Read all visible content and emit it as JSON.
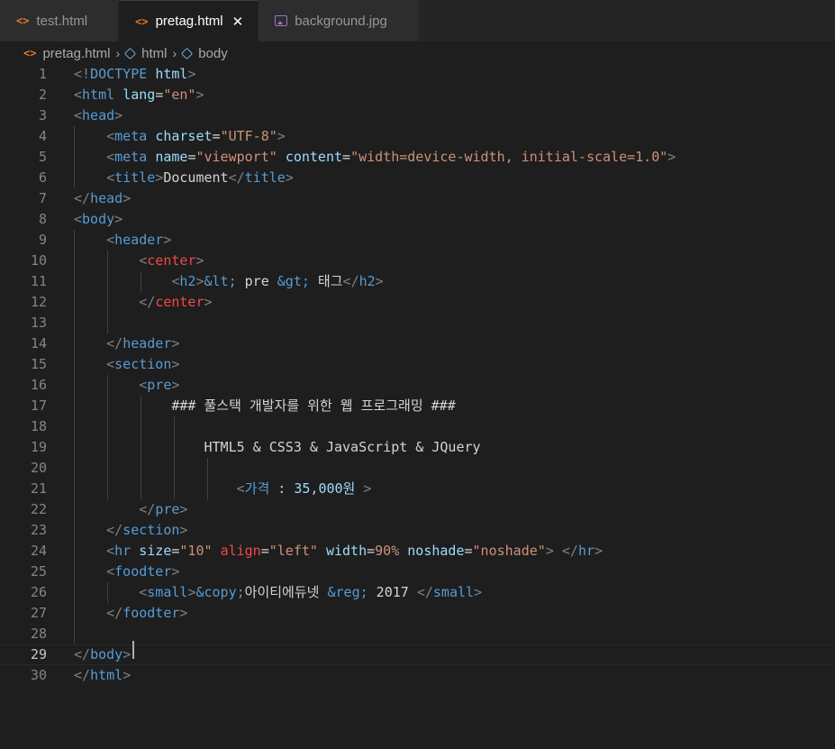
{
  "tabs": [
    {
      "label": "test.html",
      "icon": "html-file-icon",
      "active": false
    },
    {
      "label": "pretag.html",
      "icon": "html-file-icon",
      "active": true,
      "close": "✕"
    },
    {
      "label": "background.jpg",
      "icon": "image-file-icon",
      "active": false
    }
  ],
  "breadcrumb": [
    "pretag.html",
    "html",
    "body"
  ],
  "lines": [
    [
      [
        "t",
        "<!"
      ],
      [
        "n",
        "DOCTYPE"
      ],
      [
        "x",
        " "
      ],
      [
        "a",
        "html"
      ],
      [
        "t",
        ">"
      ]
    ],
    [
      [
        "t",
        "<"
      ],
      [
        "n",
        "html"
      ],
      [
        "x",
        " "
      ],
      [
        "a",
        "lang"
      ],
      [
        "x",
        "="
      ],
      [
        "s",
        "\"en\""
      ],
      [
        "t",
        ">"
      ]
    ],
    [
      [
        "t",
        "<"
      ],
      [
        "n",
        "head"
      ],
      [
        "t",
        ">"
      ]
    ],
    [
      [
        "x",
        "    "
      ],
      [
        "t",
        "<"
      ],
      [
        "n",
        "meta"
      ],
      [
        "x",
        " "
      ],
      [
        "a",
        "charset"
      ],
      [
        "x",
        "="
      ],
      [
        "s",
        "\"UTF-8\""
      ],
      [
        "t",
        ">"
      ]
    ],
    [
      [
        "x",
        "    "
      ],
      [
        "t",
        "<"
      ],
      [
        "n",
        "meta"
      ],
      [
        "x",
        " "
      ],
      [
        "a",
        "name"
      ],
      [
        "x",
        "="
      ],
      [
        "s",
        "\"viewport\""
      ],
      [
        "x",
        " "
      ],
      [
        "a",
        "content"
      ],
      [
        "x",
        "="
      ],
      [
        "s",
        "\"width=device-width, initial-scale=1.0\""
      ],
      [
        "t",
        ">"
      ]
    ],
    [
      [
        "x",
        "    "
      ],
      [
        "t",
        "<"
      ],
      [
        "n",
        "title"
      ],
      [
        "t",
        ">"
      ],
      [
        "x",
        "Document"
      ],
      [
        "t",
        "</"
      ],
      [
        "n",
        "title"
      ],
      [
        "t",
        ">"
      ]
    ],
    [
      [
        "t",
        "</"
      ],
      [
        "n",
        "head"
      ],
      [
        "t",
        ">"
      ]
    ],
    [
      [
        "t",
        "<"
      ],
      [
        "n",
        "body"
      ],
      [
        "t",
        ">"
      ]
    ],
    [
      [
        "x",
        "    "
      ],
      [
        "t",
        "<"
      ],
      [
        "n",
        "header"
      ],
      [
        "t",
        ">"
      ]
    ],
    [
      [
        "x",
        "        "
      ],
      [
        "t",
        "<"
      ],
      [
        "r",
        "center"
      ],
      [
        "t",
        ">"
      ]
    ],
    [
      [
        "x",
        "            "
      ],
      [
        "t",
        "<"
      ],
      [
        "n",
        "h2"
      ],
      [
        "t",
        ">"
      ],
      [
        "e",
        "&lt;"
      ],
      [
        "x",
        " pre "
      ],
      [
        "e",
        "&gt;"
      ],
      [
        "x",
        " 태그"
      ],
      [
        "t",
        "</"
      ],
      [
        "n",
        "h2"
      ],
      [
        "t",
        ">"
      ]
    ],
    [
      [
        "x",
        "        "
      ],
      [
        "t",
        "</"
      ],
      [
        "r",
        "center"
      ],
      [
        "t",
        ">"
      ]
    ],
    [
      [
        "x",
        ""
      ]
    ],
    [
      [
        "x",
        "    "
      ],
      [
        "t",
        "</"
      ],
      [
        "n",
        "header"
      ],
      [
        "t",
        ">"
      ]
    ],
    [
      [
        "x",
        "    "
      ],
      [
        "t",
        "<"
      ],
      [
        "n",
        "section"
      ],
      [
        "t",
        ">"
      ]
    ],
    [
      [
        "x",
        "        "
      ],
      [
        "t",
        "<"
      ],
      [
        "n",
        "pre"
      ],
      [
        "t",
        ">"
      ]
    ],
    [
      [
        "x",
        "            ### 풀스택 개발자를 위한 웹 프로그래밍 ###"
      ]
    ],
    [
      [
        "x",
        ""
      ]
    ],
    [
      [
        "x",
        "                HTML5 & CSS3 & JavaScript & JQuery"
      ]
    ],
    [
      [
        "x",
        ""
      ]
    ],
    [
      [
        "x",
        "                    "
      ],
      [
        "t",
        "<"
      ],
      [
        "n",
        "가격"
      ],
      [
        "x",
        " "
      ],
      [
        "a",
        ": 35,000원"
      ],
      [
        "x",
        " "
      ],
      [
        "t",
        ">"
      ]
    ],
    [
      [
        "x",
        "        "
      ],
      [
        "t",
        "</"
      ],
      [
        "n",
        "pre"
      ],
      [
        "t",
        ">"
      ]
    ],
    [
      [
        "x",
        "    "
      ],
      [
        "t",
        "</"
      ],
      [
        "n",
        "section"
      ],
      [
        "t",
        ">"
      ]
    ],
    [
      [
        "x",
        "    "
      ],
      [
        "t",
        "<"
      ],
      [
        "n",
        "hr"
      ],
      [
        "x",
        " "
      ],
      [
        "a",
        "size"
      ],
      [
        "x",
        "="
      ],
      [
        "s",
        "\"10\""
      ],
      [
        "x",
        " "
      ],
      [
        "r",
        "align"
      ],
      [
        "x",
        "="
      ],
      [
        "s",
        "\"left\""
      ],
      [
        "x",
        " "
      ],
      [
        "a",
        "width"
      ],
      [
        "x",
        "="
      ],
      [
        "s",
        "90%"
      ],
      [
        "x",
        " "
      ],
      [
        "a",
        "noshade"
      ],
      [
        "x",
        "="
      ],
      [
        "s",
        "\"noshade\""
      ],
      [
        "t",
        ">"
      ],
      [
        "x",
        " "
      ],
      [
        "t",
        "</"
      ],
      [
        "n",
        "hr"
      ],
      [
        "t",
        ">"
      ]
    ],
    [
      [
        "x",
        "    "
      ],
      [
        "t",
        "<"
      ],
      [
        "n",
        "foodter"
      ],
      [
        "t",
        ">"
      ]
    ],
    [
      [
        "x",
        "        "
      ],
      [
        "t",
        "<"
      ],
      [
        "n",
        "small"
      ],
      [
        "t",
        ">"
      ],
      [
        "e",
        "&copy;"
      ],
      [
        "x",
        "아이티에듀넷 "
      ],
      [
        "e",
        "&reg;"
      ],
      [
        "x",
        " 2017 "
      ],
      [
        "t",
        "</"
      ],
      [
        "n",
        "small"
      ],
      [
        "t",
        ">"
      ]
    ],
    [
      [
        "x",
        "    "
      ],
      [
        "t",
        "</"
      ],
      [
        "n",
        "foodter"
      ],
      [
        "t",
        ">"
      ]
    ],
    [
      [
        "x",
        ""
      ]
    ],
    [
      [
        "t",
        "</"
      ],
      [
        "n",
        "body"
      ],
      [
        "t",
        ">"
      ]
    ],
    [
      [
        "t",
        "</"
      ],
      [
        "n",
        "html"
      ],
      [
        "t",
        ">"
      ]
    ]
  ],
  "current_line": 29
}
